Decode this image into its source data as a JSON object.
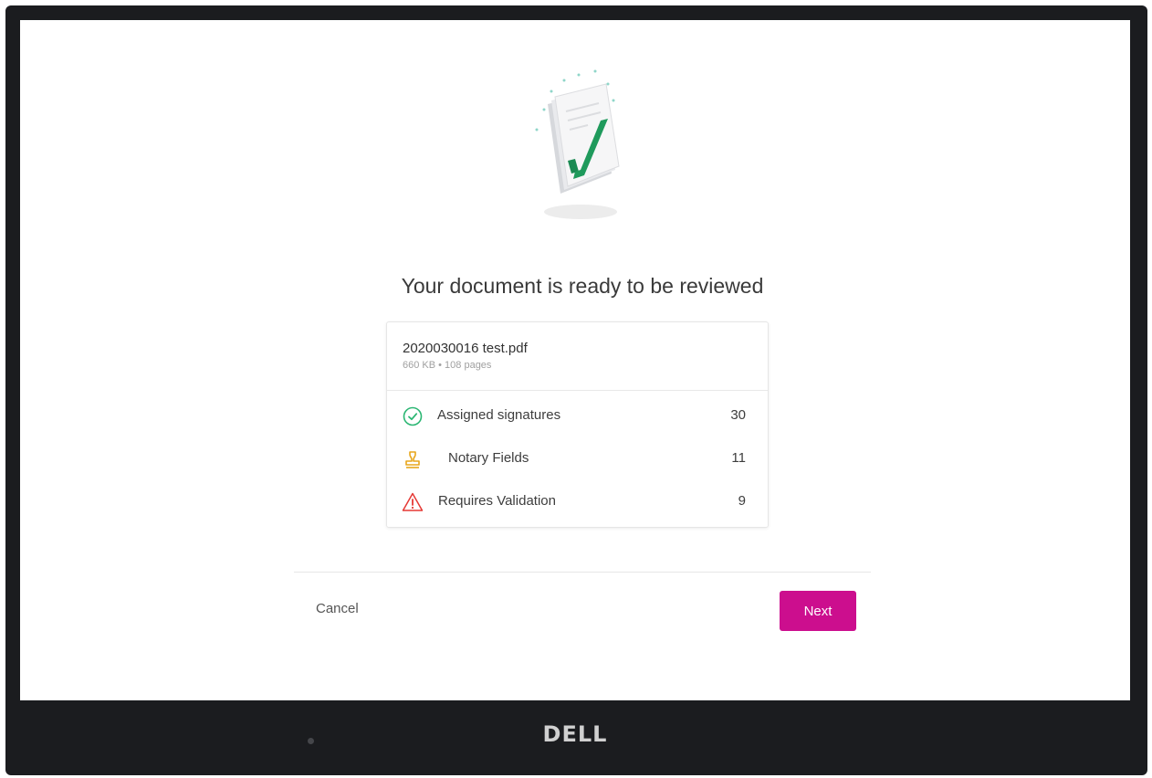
{
  "dialog": {
    "title": "Your document is ready to be reviewed",
    "file": {
      "name": "2020030016 test.pdf",
      "meta": "660 KB • 108 pages"
    },
    "stats": [
      {
        "label": "Assigned signatures",
        "count": "30",
        "icon": "check-circle-icon",
        "color": "#2bb673"
      },
      {
        "label": "Notary Fields",
        "count": "11",
        "icon": "stamp-icon",
        "color": "#e8a61b"
      },
      {
        "label": "Requires Validation",
        "count": "9",
        "icon": "warning-icon",
        "color": "#e53935"
      }
    ],
    "cancel_label": "Cancel",
    "next_label": "Next"
  },
  "accent_color": "#cc0e8e",
  "device": {
    "brand": "DELL"
  }
}
